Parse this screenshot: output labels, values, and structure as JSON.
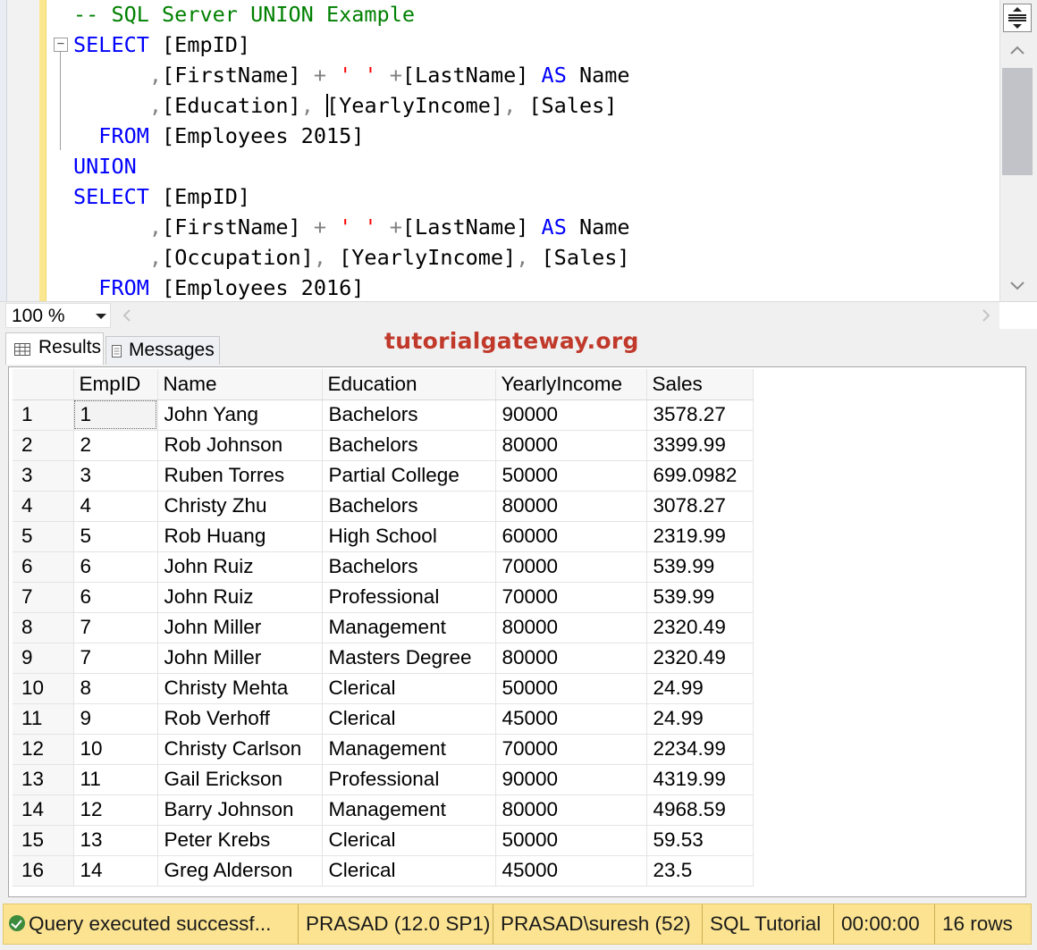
{
  "editor": {
    "lines": [
      [
        [
          "cm",
          "-- SQL Server UNION Example"
        ]
      ],
      [
        [
          "kw",
          "SELECT"
        ],
        [
          "",
          " [EmpID]"
        ]
      ],
      [
        [
          "",
          "      "
        ],
        [
          "op",
          ","
        ],
        [
          "",
          "[FirstName] "
        ],
        [
          "op",
          "+"
        ],
        [
          "",
          " "
        ],
        [
          "str",
          "' '"
        ],
        [
          "",
          " "
        ],
        [
          "op",
          "+"
        ],
        [
          "",
          "[LastName] "
        ],
        [
          "kw",
          "AS"
        ],
        [
          "",
          " Name"
        ]
      ],
      [
        [
          "",
          "      "
        ],
        [
          "op",
          ","
        ],
        [
          "",
          "[Education]"
        ],
        [
          "op",
          ","
        ],
        [
          "",
          " "
        ],
        [
          "caret",
          ""
        ],
        [
          "",
          "[YearlyIncome]"
        ],
        [
          "op",
          ","
        ],
        [
          "",
          " [Sales]"
        ]
      ],
      [
        [
          "",
          "  "
        ],
        [
          "kw",
          "FROM"
        ],
        [
          "",
          " [Employees 2015]"
        ]
      ],
      [
        [
          "kw",
          "UNION"
        ]
      ],
      [
        [
          "kw",
          "SELECT"
        ],
        [
          "",
          " [EmpID]"
        ]
      ],
      [
        [
          "",
          "      "
        ],
        [
          "op",
          ","
        ],
        [
          "",
          "[FirstName] "
        ],
        [
          "op",
          "+"
        ],
        [
          "",
          " "
        ],
        [
          "str",
          "' '"
        ],
        [
          "",
          " "
        ],
        [
          "op",
          "+"
        ],
        [
          "",
          "[LastName] "
        ],
        [
          "kw",
          "AS"
        ],
        [
          "",
          " Name"
        ]
      ],
      [
        [
          "",
          "      "
        ],
        [
          "op",
          ","
        ],
        [
          "",
          "[Occupation]"
        ],
        [
          "op",
          ","
        ],
        [
          "",
          " [YearlyIncome]"
        ],
        [
          "op",
          ","
        ],
        [
          "",
          " [Sales]"
        ]
      ],
      [
        [
          "",
          "  "
        ],
        [
          "kw",
          "FROM"
        ],
        [
          "",
          " [Employees 2016]"
        ]
      ]
    ]
  },
  "zoom": {
    "value": "100 %"
  },
  "tabs": {
    "results": "Results",
    "messages": "Messages"
  },
  "watermark": "tutorialgateway.org",
  "grid": {
    "columns": [
      "",
      "EmpID",
      "Name",
      "Education",
      "YearlyIncome",
      "Sales"
    ],
    "rows": [
      [
        "1",
        "1",
        "John Yang",
        "Bachelors",
        "90000",
        "3578.27"
      ],
      [
        "2",
        "2",
        "Rob Johnson",
        "Bachelors",
        "80000",
        "3399.99"
      ],
      [
        "3",
        "3",
        "Ruben Torres",
        "Partial College",
        "50000",
        "699.0982"
      ],
      [
        "4",
        "4",
        "Christy Zhu",
        "Bachelors",
        "80000",
        "3078.27"
      ],
      [
        "5",
        "5",
        "Rob Huang",
        "High School",
        "60000",
        "2319.99"
      ],
      [
        "6",
        "6",
        "John Ruiz",
        "Bachelors",
        "70000",
        "539.99"
      ],
      [
        "7",
        "6",
        "John Ruiz",
        "Professional",
        "70000",
        "539.99"
      ],
      [
        "8",
        "7",
        "John Miller",
        "Management",
        "80000",
        "2320.49"
      ],
      [
        "9",
        "7",
        "John Miller",
        "Masters Degree",
        "80000",
        "2320.49"
      ],
      [
        "10",
        "8",
        "Christy Mehta",
        "Clerical",
        "50000",
        "24.99"
      ],
      [
        "11",
        "9",
        "Rob Verhoff",
        "Clerical",
        "45000",
        "24.99"
      ],
      [
        "12",
        "10",
        "Christy Carlson",
        "Management",
        "70000",
        "2234.99"
      ],
      [
        "13",
        "11",
        "Gail Erickson",
        "Professional",
        "90000",
        "4319.99"
      ],
      [
        "14",
        "12",
        "Barry Johnson",
        "Management",
        "80000",
        "4968.59"
      ],
      [
        "15",
        "13",
        "Peter Krebs",
        "Clerical",
        "50000",
        "59.53"
      ],
      [
        "16",
        "14",
        "Greg Alderson",
        "Clerical",
        "45000",
        "23.5"
      ]
    ]
  },
  "status": {
    "message": "Query executed successf...",
    "server": "PRASAD (12.0 SP1)",
    "user": "PRASAD\\suresh (52)",
    "database": "SQL Tutorial",
    "elapsed": "00:00:00",
    "rows": "16 rows"
  },
  "colors": {
    "keyword": "#0000ff",
    "comment": "#008000",
    "string": "#ff0000",
    "operator": "#808080",
    "status_bar": "#fbe391",
    "change_bar": "#fbe78f",
    "watermark": "#c0392b"
  },
  "icons": {
    "status": "check-circle-icon",
    "results_tab": "grid-icon",
    "messages_tab": "document-icon",
    "split": "split-view-icon"
  }
}
